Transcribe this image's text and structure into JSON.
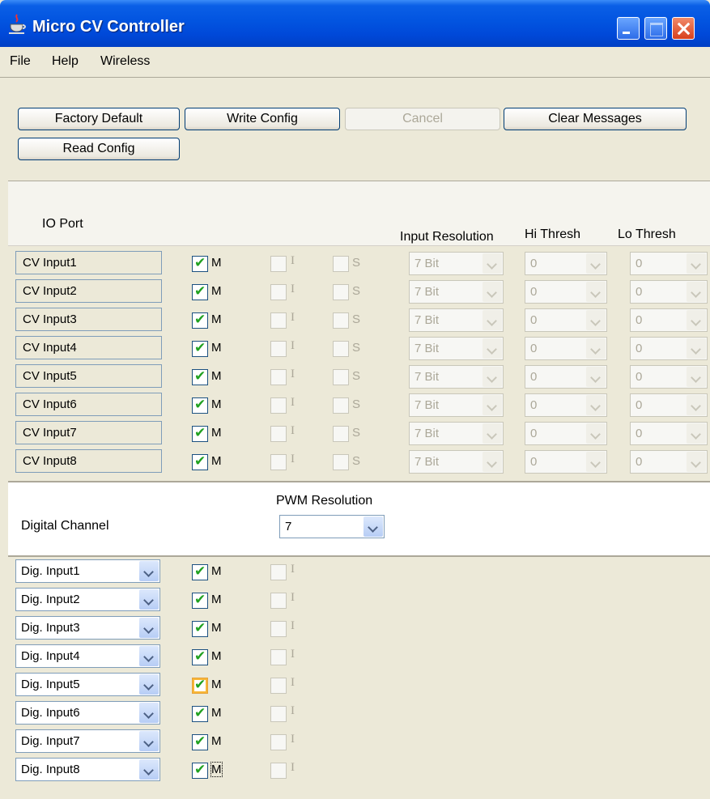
{
  "window": {
    "title": "Micro CV Controller"
  },
  "menu": [
    "File",
    "Help",
    "Wireless"
  ],
  "buttons": {
    "factory_default": "Factory Default",
    "write_config": "Write Config",
    "cancel": "Cancel",
    "clear_messages": "Clear Messages",
    "read_config": "Read Config"
  },
  "cv_panel": {
    "headers": {
      "io_port": "IO Port",
      "input_resolution": "Input Resolution",
      "hi_thresh": "Hi Thresh",
      "lo_thresh": "Lo Thresh"
    },
    "flag_labels": {
      "m": "M",
      "i": "I",
      "s": "S"
    },
    "rows": [
      {
        "name": "CV Input1",
        "m": true,
        "i": false,
        "s": false,
        "resolution": "7 Bit",
        "hi": "0",
        "lo": "0"
      },
      {
        "name": "CV Input2",
        "m": true,
        "i": false,
        "s": false,
        "resolution": "7 Bit",
        "hi": "0",
        "lo": "0"
      },
      {
        "name": "CV Input3",
        "m": true,
        "i": false,
        "s": false,
        "resolution": "7 Bit",
        "hi": "0",
        "lo": "0"
      },
      {
        "name": "CV Input4",
        "m": true,
        "i": false,
        "s": false,
        "resolution": "7 Bit",
        "hi": "0",
        "lo": "0"
      },
      {
        "name": "CV Input5",
        "m": true,
        "i": false,
        "s": false,
        "resolution": "7 Bit",
        "hi": "0",
        "lo": "0"
      },
      {
        "name": "CV Input6",
        "m": true,
        "i": false,
        "s": false,
        "resolution": "7 Bit",
        "hi": "0",
        "lo": "0"
      },
      {
        "name": "CV Input7",
        "m": true,
        "i": false,
        "s": false,
        "resolution": "7 Bit",
        "hi": "0",
        "lo": "0"
      },
      {
        "name": "CV Input8",
        "m": true,
        "i": false,
        "s": false,
        "resolution": "7 Bit",
        "hi": "0",
        "lo": "0"
      }
    ]
  },
  "digital_panel": {
    "channel_label": "Digital Channel",
    "pwm_label": "PWM Resolution",
    "pwm_value": "7",
    "flag_labels": {
      "m": "M",
      "i": "I"
    },
    "rows": [
      {
        "name": "Dig. Input1",
        "m": true,
        "i": false
      },
      {
        "name": "Dig. Input2",
        "m": true,
        "i": false
      },
      {
        "name": "Dig. Input3",
        "m": true,
        "i": false
      },
      {
        "name": "Dig. Input4",
        "m": true,
        "i": false
      },
      {
        "name": "Dig. Input5",
        "m": true,
        "i": false
      },
      {
        "name": "Dig. Input6",
        "m": true,
        "i": false
      },
      {
        "name": "Dig. Input7",
        "m": true,
        "i": false
      },
      {
        "name": "Dig. Input8",
        "m": true,
        "i": false
      }
    ]
  }
}
